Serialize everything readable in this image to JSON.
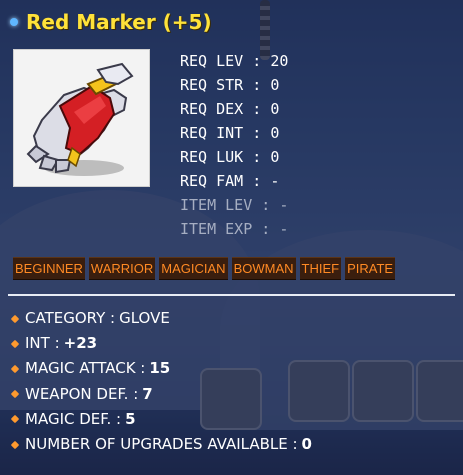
{
  "item": {
    "name": "Red Marker (+5)",
    "icon": "red-glove-icon"
  },
  "requirements": [
    {
      "label": "REQ LEV",
      "value": "20",
      "active": true
    },
    {
      "label": "REQ STR",
      "value": "0",
      "active": true
    },
    {
      "label": "REQ DEX",
      "value": "0",
      "active": true
    },
    {
      "label": "REQ INT",
      "value": "0",
      "active": true
    },
    {
      "label": "REQ LUK",
      "value": "0",
      "active": true
    },
    {
      "label": "REQ FAM",
      "value": "-",
      "active": true
    },
    {
      "label": "ITEM LEV",
      "value": "-",
      "active": false
    },
    {
      "label": "ITEM EXP",
      "value": "-",
      "active": false
    }
  ],
  "jobs": [
    "BEGINNER",
    "WARRIOR",
    "MAGICIAN",
    "BOWMAN",
    "THIEF",
    "PIRATE"
  ],
  "stats": [
    {
      "label": "CATEGORY :",
      "value": "GLOVE"
    },
    {
      "label": "INT :",
      "value": "+23"
    },
    {
      "label": "MAGIC ATTACK :",
      "value": "15"
    },
    {
      "label": "WEAPON DEF. :",
      "value": "7"
    },
    {
      "label": "MAGIC DEF. :",
      "value": "5"
    },
    {
      "label": "NUMBER OF UPGRADES AVAILABLE :",
      "value": "0"
    }
  ],
  "colors": {
    "title": "#ffe23a",
    "job_text": "#ff8a24",
    "job_bg": "#3a1e0e",
    "stat_bullet": "#ff9a2e"
  }
}
